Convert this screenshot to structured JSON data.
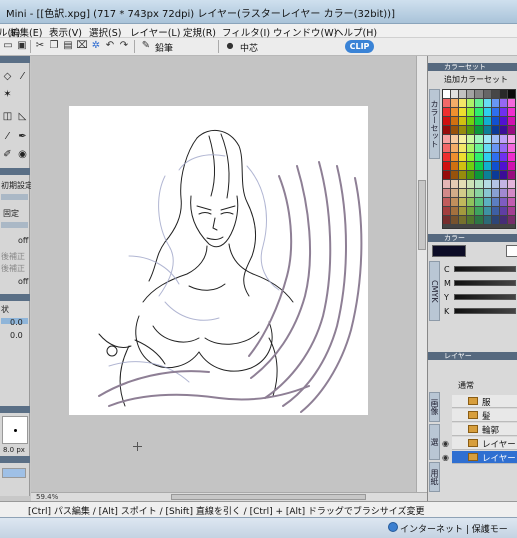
{
  "window": {
    "title": "Mini - [[色訳.xpg] (717 * 743px 72dpi)   レイヤー(ラスターレイヤー カラー(32bit))]"
  },
  "menu": {
    "items": [
      "編集(E)",
      "表示(V)",
      "選択(S)",
      "レイヤー(L)",
      "定規(R)",
      "フィルタ(I)",
      "ウィンドウ(W)",
      "ヘルプ(H)"
    ],
    "prefix": "ル(F)"
  },
  "toolbar": {
    "brush_label": "鉛筆",
    "origin_label": "中芯"
  },
  "left_panel": {
    "initial_setting": "初期設定",
    "fixed": "固定",
    "off1": "off",
    "post_correction1": "後補正",
    "post_correction2": "後補正",
    "off2": "off",
    "shape_label": "状",
    "value1": "0.0",
    "value2": "0.0",
    "size_value": "8.0 px"
  },
  "canvas": {
    "zoom": "59.4%"
  },
  "right_panel": {
    "color_set_header": "カラーセット",
    "add_color_set": "追加カラーセット",
    "color_set_tab": "カラーセット",
    "color_header": "カラー",
    "cmyk_tab": "CMYK",
    "cmyk_labels": [
      "C",
      "M",
      "Y",
      "K"
    ],
    "layer_header": "レイヤー",
    "layer_mode": "通常",
    "layers": [
      {
        "name": "服",
        "visible": false,
        "selected": false
      },
      {
        "name": "髪",
        "visible": false,
        "selected": false
      },
      {
        "name": "輪郭",
        "visible": false,
        "selected": false
      },
      {
        "name": "レイヤー",
        "visible": true,
        "selected": false
      },
      {
        "name": "レイヤー",
        "visible": true,
        "selected": true
      }
    ],
    "layer_tabs": [
      "画像",
      "選",
      "用紙"
    ],
    "colors": {
      "main": "#0c0c26",
      "sub": "#ffffff"
    }
  },
  "statusbar": {
    "hint": "[Ctrl] パス編集 / [Alt] スポイト / [Shift] 直線を引く / [Ctrl] + [Alt] ドラッグでブラシサイズ変更"
  },
  "taskbar": {
    "zone": "インターネット | 保護モー"
  }
}
